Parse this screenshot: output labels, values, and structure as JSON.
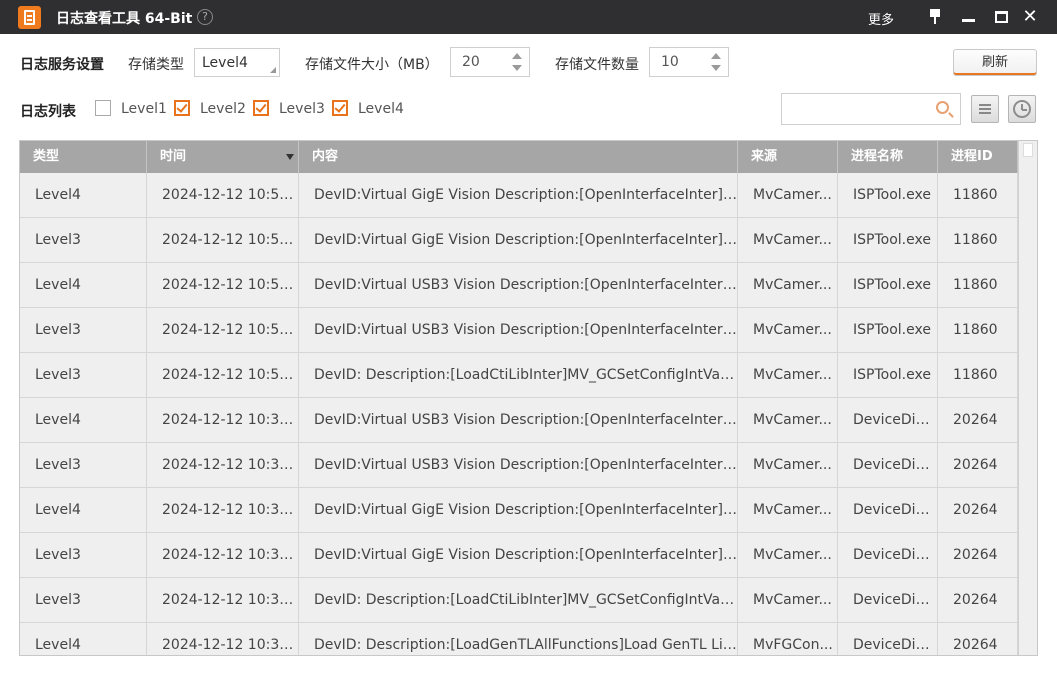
{
  "window": {
    "title": "日志查看工具 64-Bit",
    "help": "?",
    "more": "更多",
    "close": "✕"
  },
  "settings": {
    "section_label": "日志服务设置",
    "storage_type_label": "存储类型",
    "storage_type_value": "Level4",
    "file_size_label": "存储文件大小（MB）",
    "file_size_value": "20",
    "file_count_label": "存储文件数量",
    "file_count_value": "10",
    "refresh_label": "刷新"
  },
  "filter": {
    "section_label": "日志列表",
    "levels": [
      {
        "label": "Level1",
        "checked": false
      },
      {
        "label": "Level2",
        "checked": true
      },
      {
        "label": "Level3",
        "checked": true
      },
      {
        "label": "Level4",
        "checked": true
      }
    ],
    "search_value": ""
  },
  "table": {
    "columns": [
      "类型",
      "时间",
      "内容",
      "来源",
      "进程名称",
      "进程ID"
    ],
    "rows": [
      [
        "Level4",
        "2024-12-12 10:50:...",
        "DevID:Virtual GigE Vision  Description:[OpenInterfaceInter]In...",
        "MvCamer...",
        "ISPTool.exe",
        "11860"
      ],
      [
        "Level3",
        "2024-12-12 10:50:...",
        "DevID:Virtual GigE Vision  Description:[OpenInterfaceInter]G...",
        "MvCamer...",
        "ISPTool.exe",
        "11860"
      ],
      [
        "Level4",
        "2024-12-12 10:50:...",
        "DevID:Virtual USB3 Vision  Description:[OpenInterfaceInter]I...",
        "MvCamer...",
        "ISPTool.exe",
        "11860"
      ],
      [
        "Level3",
        "2024-12-12 10:50:...",
        "DevID:Virtual USB3 Vision  Description:[OpenInterfaceInter]G...",
        "MvCamer...",
        "ISPTool.exe",
        "11860"
      ],
      [
        "Level3",
        "2024-12-12 10:50:...",
        "DevID:  Description:[LoadCtiLibInter]MV_GCSetConfigIntValu...",
        "MvCamer...",
        "ISPTool.exe",
        "11860"
      ],
      [
        "Level4",
        "2024-12-12 10:39:...",
        "DevID:Virtual USB3 Vision  Description:[OpenInterfaceInter]I...",
        "MvCamer...",
        "DeviceDia...",
        "20264"
      ],
      [
        "Level3",
        "2024-12-12 10:39:...",
        "DevID:Virtual USB3 Vision  Description:[OpenInterfaceInter]G...",
        "MvCamer...",
        "DeviceDia...",
        "20264"
      ],
      [
        "Level4",
        "2024-12-12 10:39:...",
        "DevID:Virtual GigE Vision  Description:[OpenInterfaceInter]In...",
        "MvCamer...",
        "DeviceDia...",
        "20264"
      ],
      [
        "Level3",
        "2024-12-12 10:39:...",
        "DevID:Virtual GigE Vision  Description:[OpenInterfaceInter]G...",
        "MvCamer...",
        "DeviceDia...",
        "20264"
      ],
      [
        "Level3",
        "2024-12-12 10:39:...",
        "DevID:  Description:[LoadCtiLibInter]MV_GCSetConfigIntValu...",
        "MvCamer...",
        "DeviceDia...",
        "20264"
      ],
      [
        "Level4",
        "2024-12-12 10:39:...",
        "DevID:  Description:[LoadGenTLAllFunctions]Load GenTL Lib...",
        "MvFGCon...",
        "DeviceDia...",
        "20264"
      ]
    ]
  },
  "colors": {
    "accent": "#e8731c",
    "titlebar": "#2f2f31",
    "header_bg": "#a6a6a6",
    "row_bg": "#efefef"
  },
  "icons": {
    "app": "log-document-icon",
    "search": "search-icon",
    "list": "list-icon",
    "history": "clock-icon"
  }
}
